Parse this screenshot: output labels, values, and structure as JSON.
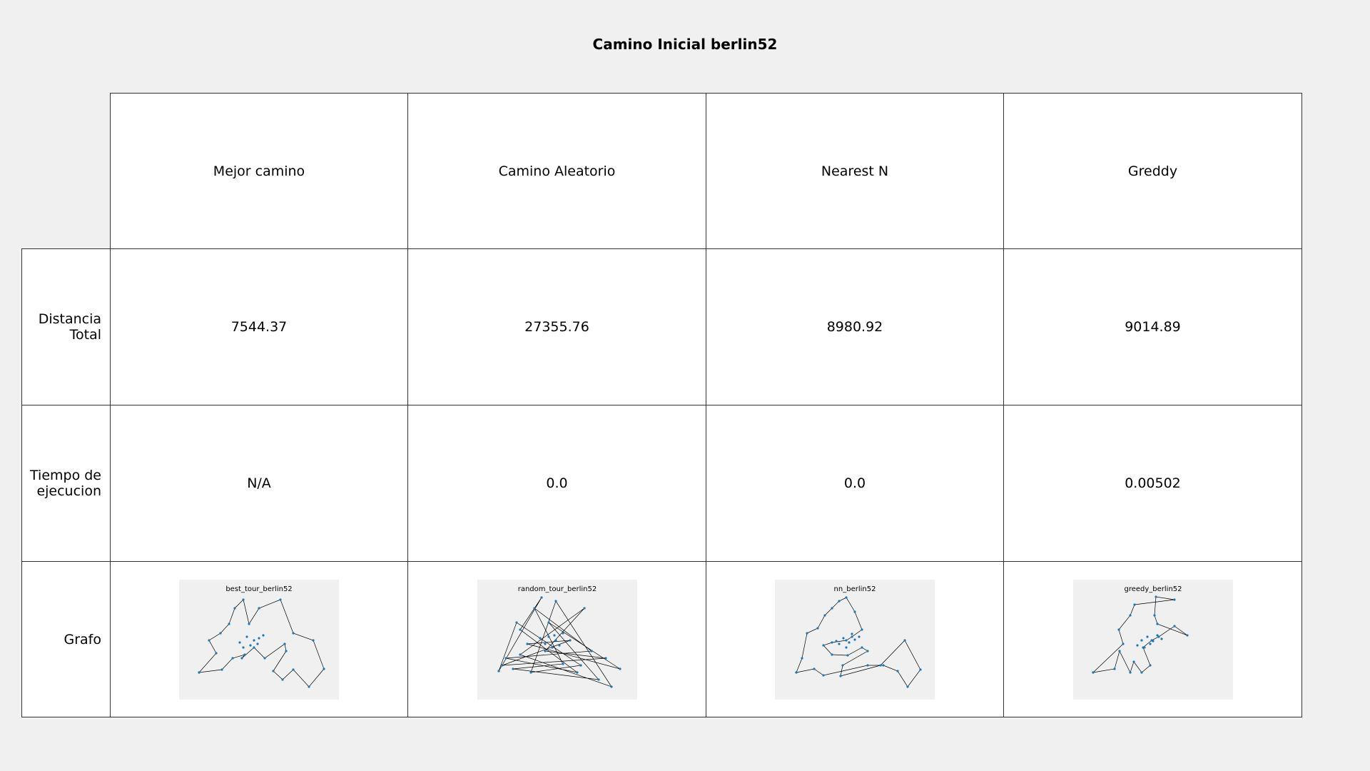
{
  "title": "Camino Inicial berlin52",
  "chart_data": {
    "type": "table",
    "title": "Camino Inicial berlin52",
    "columns": [
      "Mejor camino",
      "Camino Aleatorio",
      "Nearest N",
      "Greddy"
    ],
    "row_labels": [
      "Distancia Total",
      "Tiempo de ejecucion",
      "Grafo"
    ],
    "rows": {
      "distancia_total": [
        "7544.37",
        "27355.76",
        "8980.92",
        "9014.89"
      ],
      "tiempo_de_ejecucion": [
        "N/A",
        "0.0",
        "0.0",
        "0.00502"
      ]
    },
    "thumbnails": [
      {
        "title": "best_tour_berlin52"
      },
      {
        "title": "random_tour_berlin52"
      },
      {
        "title": "nn_berlin52"
      },
      {
        "title": "greedy_berlin52"
      }
    ]
  },
  "labels": {
    "row1": [
      "Distancia",
      "Total"
    ],
    "row2": [
      "Tiempo de",
      "ejecucion"
    ],
    "row3": "Grafo"
  },
  "colors": {
    "node": "#1f77b4",
    "edge": "#000000",
    "grid_line": "#333333",
    "background": "#f0f0f0"
  }
}
